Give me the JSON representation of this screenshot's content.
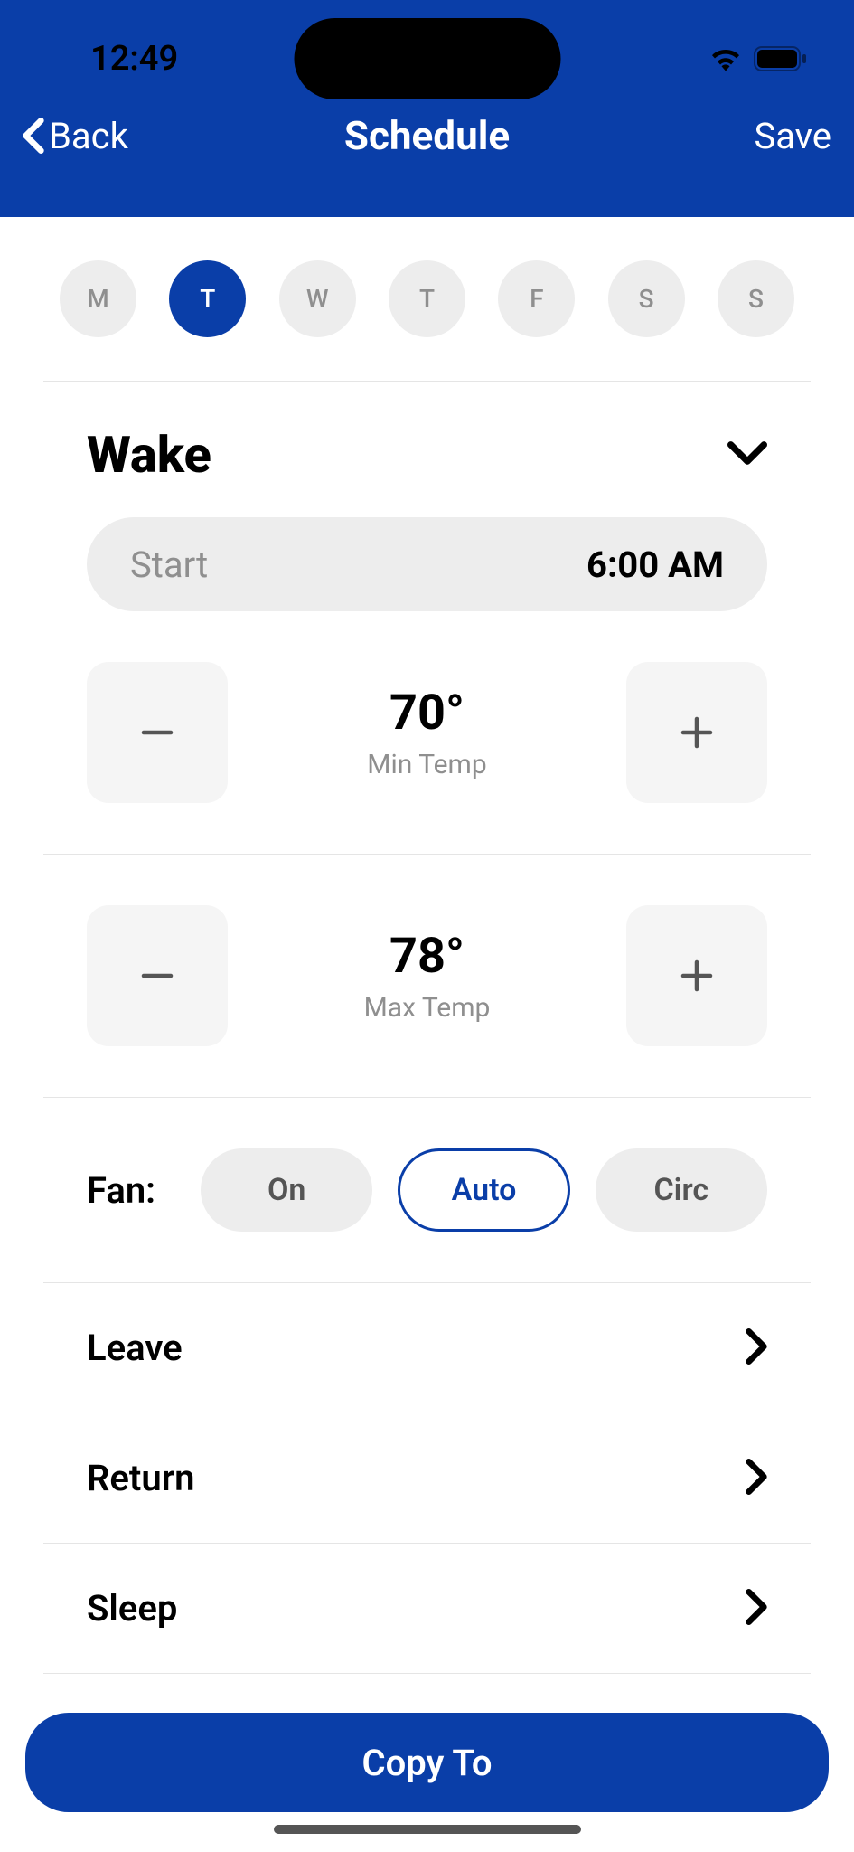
{
  "status": {
    "time": "12:49"
  },
  "nav": {
    "back": "Back",
    "title": "Schedule",
    "save": "Save"
  },
  "days": [
    {
      "label": "M",
      "selected": false
    },
    {
      "label": "T",
      "selected": true
    },
    {
      "label": "W",
      "selected": false
    },
    {
      "label": "T",
      "selected": false
    },
    {
      "label": "F",
      "selected": false
    },
    {
      "label": "S",
      "selected": false
    },
    {
      "label": "S",
      "selected": false
    }
  ],
  "wake": {
    "title": "Wake",
    "start_label": "Start",
    "start_value": "6:00 AM",
    "min_temp": "70°",
    "min_temp_label": "Min Temp",
    "max_temp": "78°",
    "max_temp_label": "Max Temp"
  },
  "fan": {
    "label": "Fan:",
    "options": [
      {
        "label": "On",
        "selected": false
      },
      {
        "label": "Auto",
        "selected": true
      },
      {
        "label": "Circ",
        "selected": false
      }
    ]
  },
  "periods": [
    {
      "label": "Leave"
    },
    {
      "label": "Return"
    },
    {
      "label": "Sleep"
    }
  ],
  "footer": {
    "copy_to": "Copy To"
  }
}
